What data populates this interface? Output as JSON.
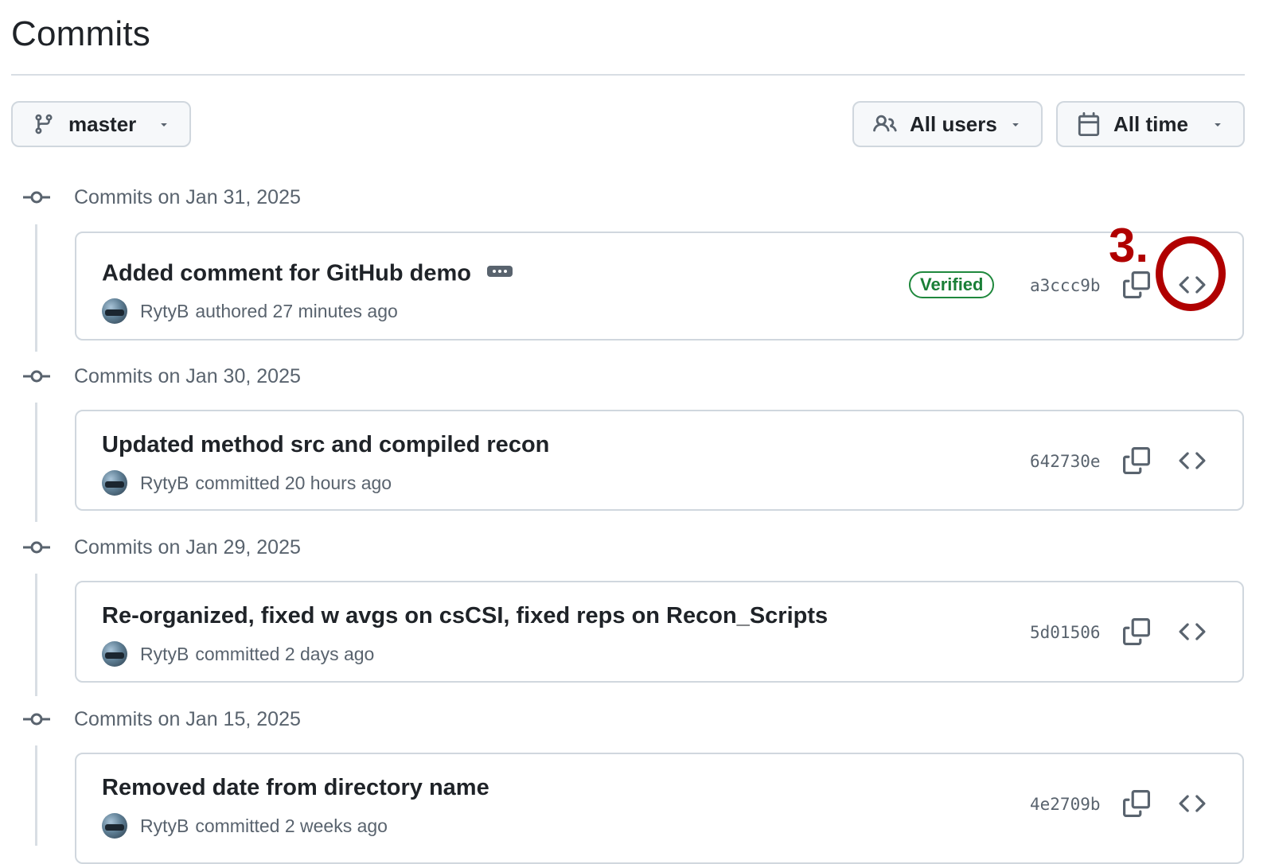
{
  "page": {
    "title": "Commits"
  },
  "filters": {
    "branch_label": "master",
    "users_label": "All users",
    "time_label": "All time"
  },
  "groups": [
    {
      "date_label": "Commits on Jan 31, 2025",
      "commit": {
        "title": "Added comment for GitHub demo",
        "author": "RytyB",
        "action": "authored 27 minutes ago",
        "verified_label": "Verified",
        "sha": "a3ccc9b"
      }
    },
    {
      "date_label": "Commits on Jan 30, 2025",
      "commit": {
        "title": "Updated method src and compiled recon",
        "author": "RytyB",
        "action": "committed 20 hours ago",
        "sha": "642730e"
      }
    },
    {
      "date_label": "Commits on Jan 29, 2025",
      "commit": {
        "title": "Re-organized, fixed w avgs on csCSI, fixed reps on Recon_Scripts",
        "author": "RytyB",
        "action": "committed 2 days ago",
        "sha": "5d01506"
      }
    },
    {
      "date_label": "Commits on Jan 15, 2025",
      "commit": {
        "title": "Removed date from directory name",
        "author": "RytyB",
        "action": "committed 2 weeks ago",
        "sha": "4e2709b"
      }
    }
  ],
  "annotation": {
    "label": "3.",
    "color": "#b00000"
  },
  "icons": {
    "branch": "git-branch-icon",
    "users": "people-icon",
    "calendar": "calendar-icon",
    "caret": "triangle-down-icon",
    "commit_node": "git-commit-icon",
    "ellipsis": "kebab-horizontal-icon",
    "copy": "copy-icon",
    "browse": "code-icon"
  },
  "colors": {
    "verified": "#1a7f37",
    "muted_text": "#59636e",
    "border": "#d0d7de"
  }
}
